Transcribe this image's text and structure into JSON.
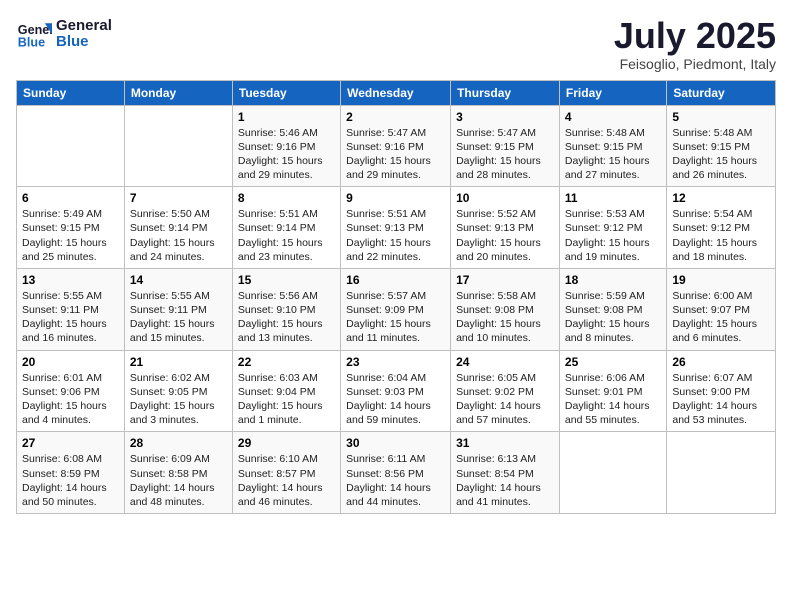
{
  "logo": {
    "line1": "General",
    "line2": "Blue"
  },
  "title": "July 2025",
  "location": "Feisoglio, Piedmont, Italy",
  "days_header": [
    "Sunday",
    "Monday",
    "Tuesday",
    "Wednesday",
    "Thursday",
    "Friday",
    "Saturday"
  ],
  "weeks": [
    [
      {
        "day": "",
        "sunrise": "",
        "sunset": "",
        "daylight": ""
      },
      {
        "day": "",
        "sunrise": "",
        "sunset": "",
        "daylight": ""
      },
      {
        "day": "1",
        "sunrise": "Sunrise: 5:46 AM",
        "sunset": "Sunset: 9:16 PM",
        "daylight": "Daylight: 15 hours and 29 minutes."
      },
      {
        "day": "2",
        "sunrise": "Sunrise: 5:47 AM",
        "sunset": "Sunset: 9:16 PM",
        "daylight": "Daylight: 15 hours and 29 minutes."
      },
      {
        "day": "3",
        "sunrise": "Sunrise: 5:47 AM",
        "sunset": "Sunset: 9:15 PM",
        "daylight": "Daylight: 15 hours and 28 minutes."
      },
      {
        "day": "4",
        "sunrise": "Sunrise: 5:48 AM",
        "sunset": "Sunset: 9:15 PM",
        "daylight": "Daylight: 15 hours and 27 minutes."
      },
      {
        "day": "5",
        "sunrise": "Sunrise: 5:48 AM",
        "sunset": "Sunset: 9:15 PM",
        "daylight": "Daylight: 15 hours and 26 minutes."
      }
    ],
    [
      {
        "day": "6",
        "sunrise": "Sunrise: 5:49 AM",
        "sunset": "Sunset: 9:15 PM",
        "daylight": "Daylight: 15 hours and 25 minutes."
      },
      {
        "day": "7",
        "sunrise": "Sunrise: 5:50 AM",
        "sunset": "Sunset: 9:14 PM",
        "daylight": "Daylight: 15 hours and 24 minutes."
      },
      {
        "day": "8",
        "sunrise": "Sunrise: 5:51 AM",
        "sunset": "Sunset: 9:14 PM",
        "daylight": "Daylight: 15 hours and 23 minutes."
      },
      {
        "day": "9",
        "sunrise": "Sunrise: 5:51 AM",
        "sunset": "Sunset: 9:13 PM",
        "daylight": "Daylight: 15 hours and 22 minutes."
      },
      {
        "day": "10",
        "sunrise": "Sunrise: 5:52 AM",
        "sunset": "Sunset: 9:13 PM",
        "daylight": "Daylight: 15 hours and 20 minutes."
      },
      {
        "day": "11",
        "sunrise": "Sunrise: 5:53 AM",
        "sunset": "Sunset: 9:12 PM",
        "daylight": "Daylight: 15 hours and 19 minutes."
      },
      {
        "day": "12",
        "sunrise": "Sunrise: 5:54 AM",
        "sunset": "Sunset: 9:12 PM",
        "daylight": "Daylight: 15 hours and 18 minutes."
      }
    ],
    [
      {
        "day": "13",
        "sunrise": "Sunrise: 5:55 AM",
        "sunset": "Sunset: 9:11 PM",
        "daylight": "Daylight: 15 hours and 16 minutes."
      },
      {
        "day": "14",
        "sunrise": "Sunrise: 5:55 AM",
        "sunset": "Sunset: 9:11 PM",
        "daylight": "Daylight: 15 hours and 15 minutes."
      },
      {
        "day": "15",
        "sunrise": "Sunrise: 5:56 AM",
        "sunset": "Sunset: 9:10 PM",
        "daylight": "Daylight: 15 hours and 13 minutes."
      },
      {
        "day": "16",
        "sunrise": "Sunrise: 5:57 AM",
        "sunset": "Sunset: 9:09 PM",
        "daylight": "Daylight: 15 hours and 11 minutes."
      },
      {
        "day": "17",
        "sunrise": "Sunrise: 5:58 AM",
        "sunset": "Sunset: 9:08 PM",
        "daylight": "Daylight: 15 hours and 10 minutes."
      },
      {
        "day": "18",
        "sunrise": "Sunrise: 5:59 AM",
        "sunset": "Sunset: 9:08 PM",
        "daylight": "Daylight: 15 hours and 8 minutes."
      },
      {
        "day": "19",
        "sunrise": "Sunrise: 6:00 AM",
        "sunset": "Sunset: 9:07 PM",
        "daylight": "Daylight: 15 hours and 6 minutes."
      }
    ],
    [
      {
        "day": "20",
        "sunrise": "Sunrise: 6:01 AM",
        "sunset": "Sunset: 9:06 PM",
        "daylight": "Daylight: 15 hours and 4 minutes."
      },
      {
        "day": "21",
        "sunrise": "Sunrise: 6:02 AM",
        "sunset": "Sunset: 9:05 PM",
        "daylight": "Daylight: 15 hours and 3 minutes."
      },
      {
        "day": "22",
        "sunrise": "Sunrise: 6:03 AM",
        "sunset": "Sunset: 9:04 PM",
        "daylight": "Daylight: 15 hours and 1 minute."
      },
      {
        "day": "23",
        "sunrise": "Sunrise: 6:04 AM",
        "sunset": "Sunset: 9:03 PM",
        "daylight": "Daylight: 14 hours and 59 minutes."
      },
      {
        "day": "24",
        "sunrise": "Sunrise: 6:05 AM",
        "sunset": "Sunset: 9:02 PM",
        "daylight": "Daylight: 14 hours and 57 minutes."
      },
      {
        "day": "25",
        "sunrise": "Sunrise: 6:06 AM",
        "sunset": "Sunset: 9:01 PM",
        "daylight": "Daylight: 14 hours and 55 minutes."
      },
      {
        "day": "26",
        "sunrise": "Sunrise: 6:07 AM",
        "sunset": "Sunset: 9:00 PM",
        "daylight": "Daylight: 14 hours and 53 minutes."
      }
    ],
    [
      {
        "day": "27",
        "sunrise": "Sunrise: 6:08 AM",
        "sunset": "Sunset: 8:59 PM",
        "daylight": "Daylight: 14 hours and 50 minutes."
      },
      {
        "day": "28",
        "sunrise": "Sunrise: 6:09 AM",
        "sunset": "Sunset: 8:58 PM",
        "daylight": "Daylight: 14 hours and 48 minutes."
      },
      {
        "day": "29",
        "sunrise": "Sunrise: 6:10 AM",
        "sunset": "Sunset: 8:57 PM",
        "daylight": "Daylight: 14 hours and 46 minutes."
      },
      {
        "day": "30",
        "sunrise": "Sunrise: 6:11 AM",
        "sunset": "Sunset: 8:56 PM",
        "daylight": "Daylight: 14 hours and 44 minutes."
      },
      {
        "day": "31",
        "sunrise": "Sunrise: 6:13 AM",
        "sunset": "Sunset: 8:54 PM",
        "daylight": "Daylight: 14 hours and 41 minutes."
      },
      {
        "day": "",
        "sunrise": "",
        "sunset": "",
        "daylight": ""
      },
      {
        "day": "",
        "sunrise": "",
        "sunset": "",
        "daylight": ""
      }
    ]
  ]
}
